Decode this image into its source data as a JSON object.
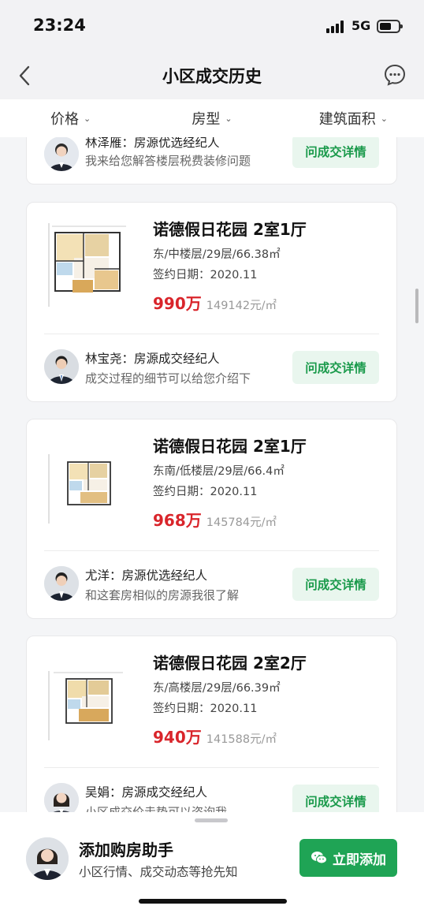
{
  "status_bar": {
    "time": "23:24",
    "network": "5G"
  },
  "nav": {
    "title": "小区成交历史"
  },
  "filters": [
    {
      "label": "价格"
    },
    {
      "label": "房型"
    },
    {
      "label": "建筑面积"
    }
  ],
  "partial_card": {
    "agent_name": "林泽雁：房源优选经纪人",
    "agent_desc": "我来给您解答楼层税费装修问题",
    "button": "问成交详情"
  },
  "listings": [
    {
      "title": "诺德假日花园 2室1厅",
      "info": "东/中楼层/29层/66.38㎡",
      "date": "签约日期：2020.11",
      "price": "990万",
      "unit_price": "149142元/㎡",
      "agent_name": "林宝尧：房源成交经纪人",
      "agent_desc": "成交过程的细节可以给您介绍下",
      "button": "问成交详情"
    },
    {
      "title": "诺德假日花园 2室1厅",
      "info": "东南/低楼层/29层/66.4㎡",
      "date": "签约日期：2020.11",
      "price": "968万",
      "unit_price": "145784元/㎡",
      "agent_name": "尤洋：房源优选经纪人",
      "agent_desc": "和这套房相似的房源我很了解",
      "button": "问成交详情"
    },
    {
      "title": "诺德假日花园 2室2厅",
      "info": "东/高楼层/29层/66.39㎡",
      "date": "签约日期：2020.11",
      "price": "940万",
      "unit_price": "141588元/㎡",
      "agent_name": "吴娟：房源成交经纪人",
      "agent_desc": "小区成交价走势可以咨询我",
      "button": "问成交详情"
    }
  ],
  "bottom": {
    "title": "添加购房助手",
    "subtitle": "小区行情、成交动态等抢先知",
    "button": "立即添加"
  },
  "colors": {
    "accent_green": "#1fa455",
    "price_red": "#d9252b"
  }
}
